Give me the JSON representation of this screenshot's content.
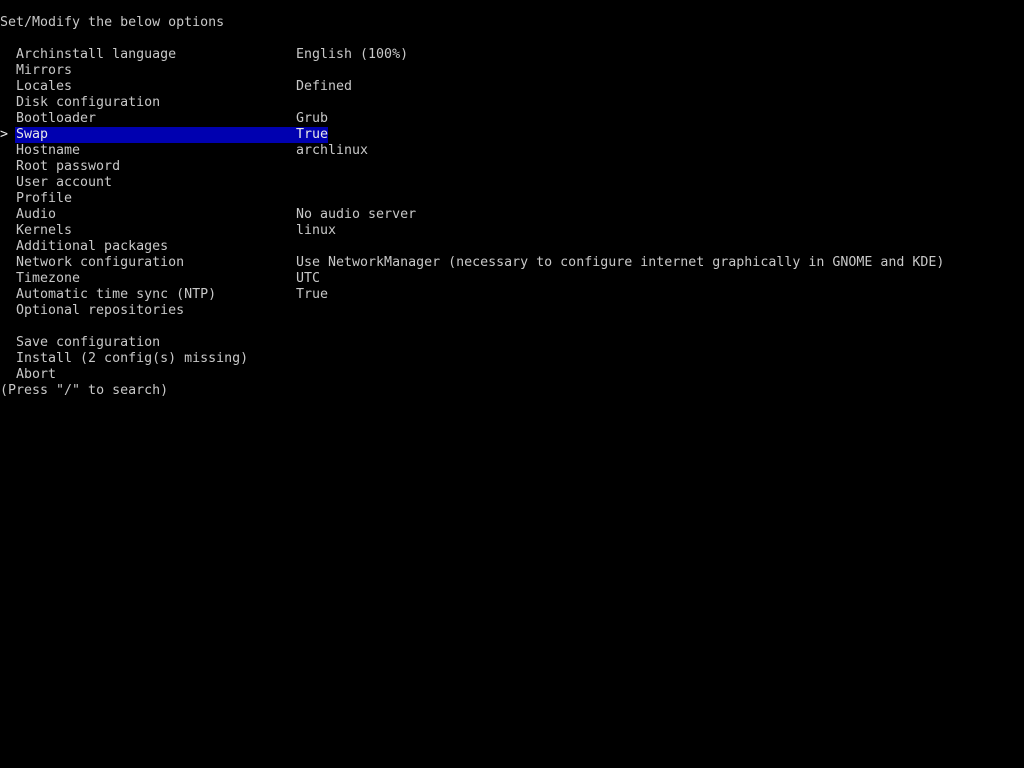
{
  "header": {
    "title": "Set/Modify the below options"
  },
  "menu": {
    "cursor_glyph": ">",
    "selected_index": 5,
    "highlight_color": "#0000b0",
    "items": [
      {
        "label": "Archinstall language",
        "value": "English (100%)"
      },
      {
        "label": "Mirrors",
        "value": ""
      },
      {
        "label": "Locales",
        "value": "Defined"
      },
      {
        "label": "Disk configuration",
        "value": ""
      },
      {
        "label": "Bootloader",
        "value": "Grub"
      },
      {
        "label": "Swap",
        "value": "True"
      },
      {
        "label": "Hostname",
        "value": "archlinux"
      },
      {
        "label": "Root password",
        "value": ""
      },
      {
        "label": "User account",
        "value": ""
      },
      {
        "label": "Profile",
        "value": ""
      },
      {
        "label": "Audio",
        "value": "No audio server"
      },
      {
        "label": "Kernels",
        "value": "linux"
      },
      {
        "label": "Additional packages",
        "value": ""
      },
      {
        "label": "Network configuration",
        "value": "Use NetworkManager (necessary to configure internet graphically in GNOME and KDE)"
      },
      {
        "label": "Timezone",
        "value": "UTC"
      },
      {
        "label": "Automatic time sync (NTP)",
        "value": "True"
      },
      {
        "label": "Optional repositories",
        "value": ""
      }
    ]
  },
  "actions": [
    {
      "label": "Save configuration"
    },
    {
      "label": "Install (2 config(s) missing)"
    },
    {
      "label": "Abort"
    }
  ],
  "footer": {
    "hint": "(Press \"/\" to search)"
  }
}
